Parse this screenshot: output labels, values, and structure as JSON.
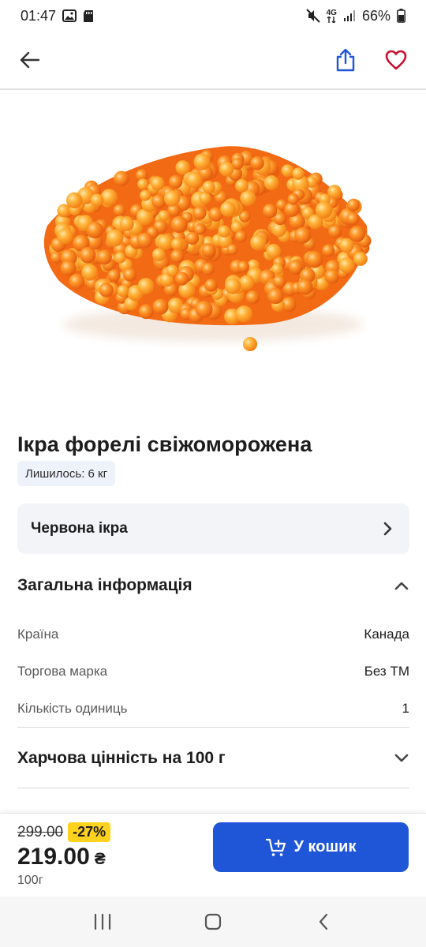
{
  "status_bar": {
    "time": "01:47",
    "battery": "66%",
    "network": "4G"
  },
  "product": {
    "title": "Ікра форелі свіжоморожена",
    "stock": "Лишилось: 6 кг",
    "image_icon": "trout-caviar-image"
  },
  "category": {
    "label": "Червона ікра"
  },
  "general_info": {
    "title": "Загальна інформація",
    "rows": [
      {
        "key": "Країна",
        "value": "Канада"
      },
      {
        "key": "Торгова марка",
        "value": "Без ТМ"
      },
      {
        "key": "Кількість одиниць",
        "value": "1"
      }
    ]
  },
  "nutrition": {
    "title": "Харчова цінність на 100 г"
  },
  "purchase": {
    "old_price": "299.00",
    "discount": "-27%",
    "price": "219.00",
    "currency": "₴",
    "unit": "100г",
    "cart_label": "У кошик"
  },
  "colors": {
    "accent": "#1f56d8",
    "favorite": "#c8102e",
    "discount": "#ffd21e"
  }
}
